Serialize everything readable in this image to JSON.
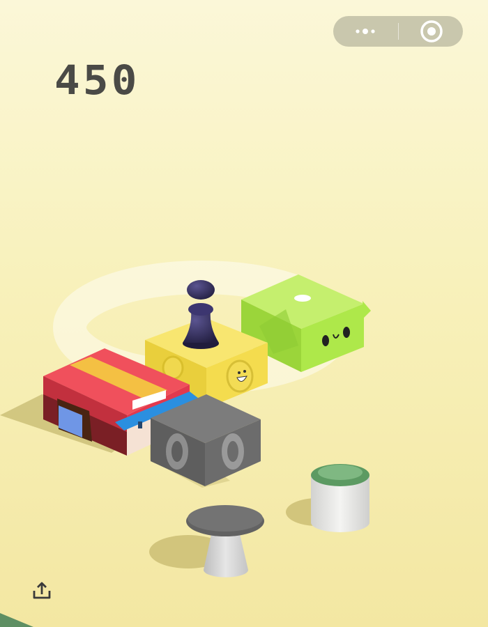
{
  "hud": {
    "score": "450"
  },
  "capsule": {
    "more_icon": "more-dots-icon",
    "close_icon": "target-circle-icon"
  },
  "share": {
    "icon": "share-upload-icon"
  },
  "colors": {
    "background": "#f7efb0",
    "score_text": "#4a4a46",
    "player_pawn": "#2e2a52",
    "yellow_block": "#f5dc55",
    "green_block": "#a4e04a",
    "red_block": "#e2394e",
    "gray_block": "#6f6f6f",
    "can_lid": "#5c9a62"
  }
}
